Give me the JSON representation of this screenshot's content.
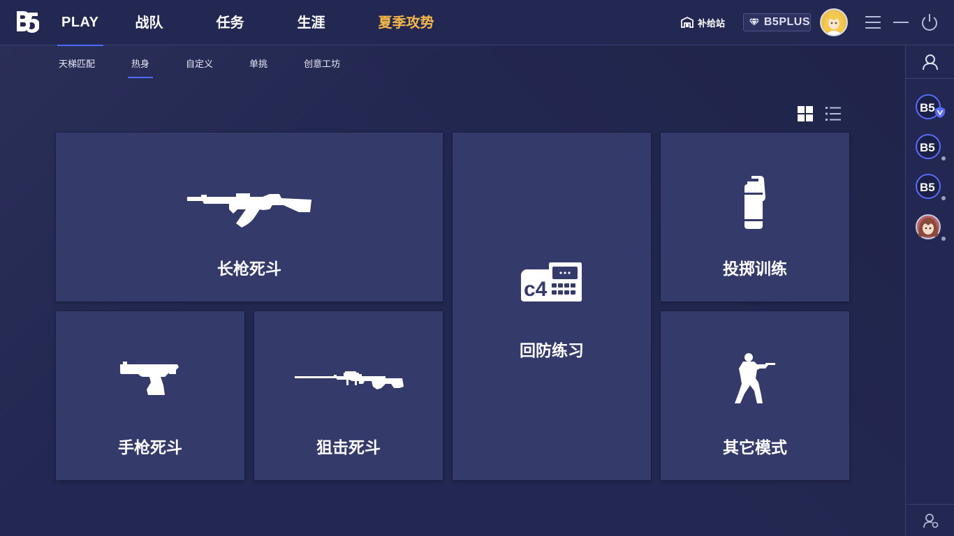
{
  "nav": {
    "play": "PLAY",
    "items": [
      "战队",
      "任务",
      "生涯",
      "夏季攻势"
    ]
  },
  "toolbar": {
    "supply_label": "补给站",
    "plus_label": "B5PLUS"
  },
  "subtabs": [
    "天梯匹配",
    "热身",
    "自定义",
    "单挑",
    "创意工坊"
  ],
  "active_subtab": "热身",
  "cards": {
    "rifle": "长枪死斗",
    "retake": "回防练习",
    "grenade": "投掷训练",
    "pistol": "手枪死斗",
    "sniper": "狙击死斗",
    "other": "其它模式"
  },
  "c4_label": "c4",
  "colors": {
    "background": "#232852",
    "card": "#343a6a",
    "accent": "#4e6bff",
    "summer": "#f6b84a"
  },
  "icons": [
    "logo-icon",
    "store-icon",
    "diamond-icon",
    "menu-icon",
    "minimize-icon",
    "power-icon",
    "grid-view-icon",
    "list-view-icon",
    "user-icon",
    "add-friend-icon"
  ]
}
